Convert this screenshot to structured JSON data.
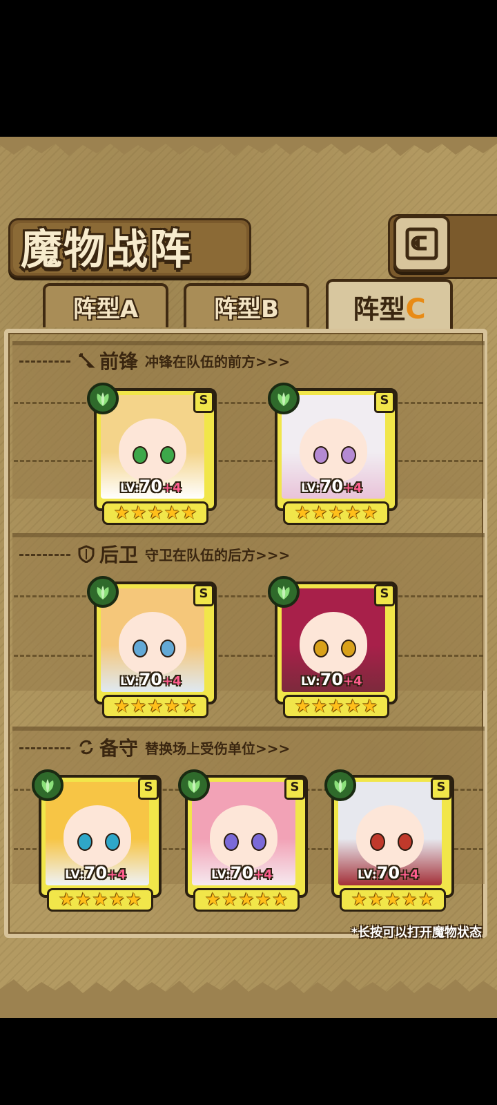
{
  "header": {
    "title": "魔物战阵",
    "back_icon": "back-arrow-icon"
  },
  "tabs": [
    {
      "label": "阵型A",
      "active": false
    },
    {
      "label": "阵型B",
      "active": false
    },
    {
      "label_main": "阵型",
      "label_letter": "C",
      "active": true
    }
  ],
  "sections": {
    "front": {
      "title": "前锋",
      "subtitle": "冲锋在队伍的前方>>>",
      "icon": "sword-icon"
    },
    "back": {
      "title": "后卫",
      "subtitle": "守卫在队伍的后方>>>",
      "icon": "shield-icon"
    },
    "reserve": {
      "title": "备守",
      "subtitle": "替换场上受伤单位>>>",
      "icon": "swap-icon"
    }
  },
  "units": [
    {
      "slot": "front",
      "rank": "S",
      "level_prefix": "LV:",
      "level": "70",
      "bonus": "+4",
      "stars": 5,
      "element": "leaf-icon",
      "hair": "#f4d48a",
      "outfit": "#ffffff",
      "eyes": "#3da84a"
    },
    {
      "slot": "front",
      "rank": "S",
      "level_prefix": "LV:",
      "level": "70",
      "bonus": "+4",
      "stars": 5,
      "element": "leaf-icon",
      "hair": "#f1edf2",
      "outfit": "#e9c3d9",
      "eyes": "#b48ad3"
    },
    {
      "slot": "back",
      "rank": "S",
      "level_prefix": "LV:",
      "level": "70",
      "bonus": "+4",
      "stars": 5,
      "element": "leaf-icon",
      "hair": "#f5c77a",
      "outfit": "#dfe9f2",
      "eyes": "#63a9d6"
    },
    {
      "slot": "back",
      "rank": "S",
      "level_prefix": "LV:",
      "level": "70",
      "bonus": "+4",
      "stars": 5,
      "element": "leaf-icon",
      "hair": "#a8204a",
      "outfit": "#7c2a3c",
      "eyes": "#d9a11a"
    },
    {
      "slot": "reserve",
      "rank": "S",
      "level_prefix": "LV:",
      "level": "70",
      "bonus": "+4",
      "stars": 5,
      "element": "leaf-icon",
      "hair": "#f7c545",
      "outfit": "#eef2f7",
      "eyes": "#2fa7c8"
    },
    {
      "slot": "reserve",
      "rank": "S",
      "level_prefix": "LV:",
      "level": "70",
      "bonus": "+4",
      "stars": 5,
      "element": "leaf-icon",
      "hair": "#f2a2b6",
      "outfit": "#f6e9ef",
      "eyes": "#7b6ad8"
    },
    {
      "slot": "reserve",
      "rank": "S",
      "level_prefix": "LV:",
      "level": "70",
      "bonus": "+4",
      "stars": 5,
      "element": "leaf-icon",
      "hair": "#e7e8ee",
      "outfit": "#a43038",
      "eyes": "#c0392b"
    }
  ],
  "footer": {
    "hint": "*长按可以打开魔物状态"
  },
  "colors": {
    "parchment": "#b49a63",
    "frame": "#d7c39a",
    "card": "#f1e64a",
    "element_bg": "#2f6a2b",
    "bonus": "#ff5d8f",
    "active_tab_letter": "#e88b15"
  }
}
